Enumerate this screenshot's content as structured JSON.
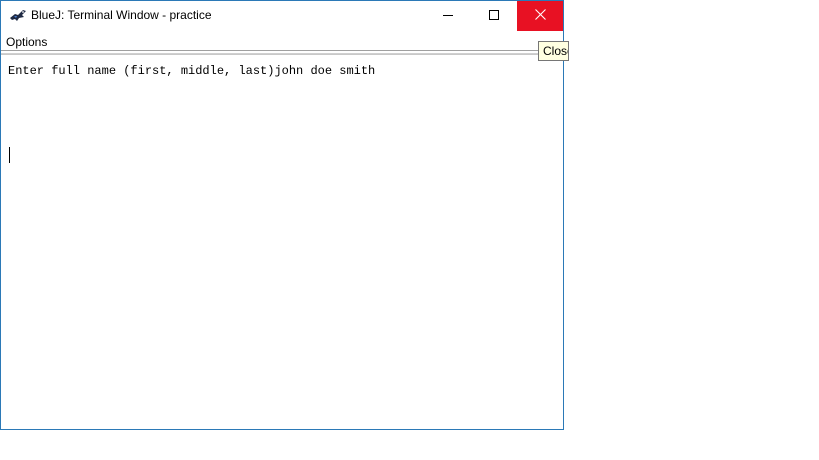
{
  "window": {
    "title": "BlueJ: Terminal Window - practice",
    "icon": "bluej-bird-icon",
    "controls": {
      "minimize_icon": "minimize-icon",
      "maximize_icon": "maximize-icon",
      "close_icon": "close-icon",
      "close_color": "#e81123"
    }
  },
  "menubar": {
    "items": [
      {
        "label": "Options"
      }
    ]
  },
  "terminal": {
    "lines": [
      "Enter full name (first, middle, last)john doe smith"
    ]
  },
  "tooltip": {
    "text": "Close"
  },
  "colors": {
    "window_border": "#2b79b7",
    "close_hover": "#e81123",
    "tooltip_bg": "#ffffe1"
  }
}
